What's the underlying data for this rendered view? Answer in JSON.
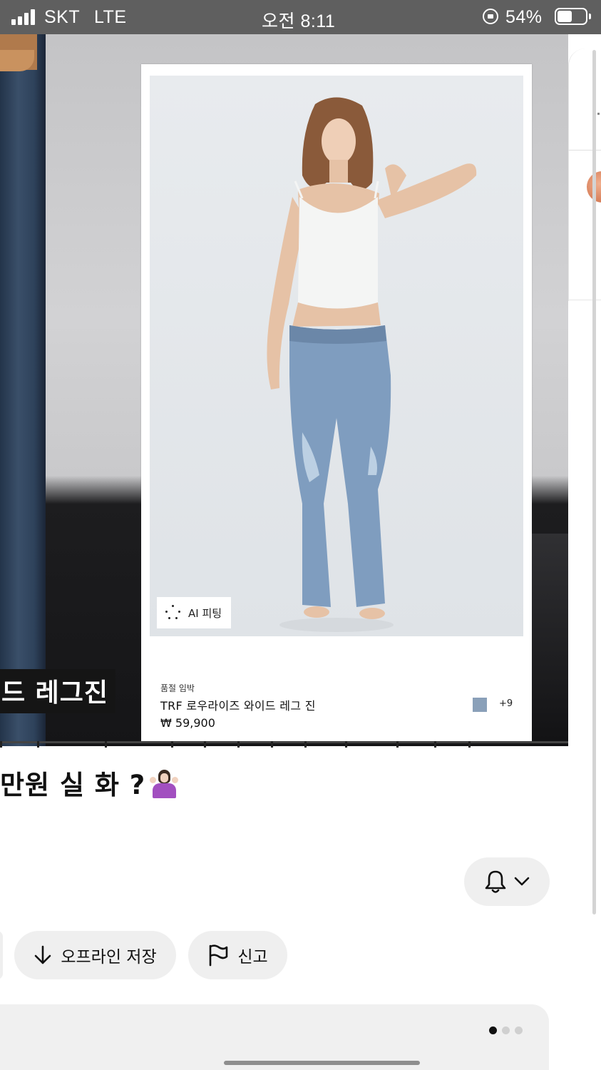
{
  "status_bar": {
    "carrier": "SKT",
    "network": "LTE",
    "time": "오전 8:11",
    "battery_percent": "54%",
    "battery_level": 0.54
  },
  "carousel": {
    "banner_text": "드 레그진"
  },
  "product_card": {
    "ai_badge_label": "AI 피팅",
    "sold_out_label": "품절 임박",
    "name": "TRF 로우라이즈 와이드 레그 진",
    "price": "₩ 59,900",
    "swatch_color": "#8aa0b9",
    "more_colors": "+9"
  },
  "caption": "만원 실 화 ?",
  "actions": {
    "bell_icon": "bell-icon",
    "offline_save_label": "오프라인 저장",
    "report_label": "신고"
  },
  "pagination": {
    "total": 3,
    "active_index": 0
  },
  "colors": {
    "status_bar_bg": "#5f5f5f",
    "pill_bg": "#efefef",
    "sheet_bg": "#f0f0f0"
  }
}
